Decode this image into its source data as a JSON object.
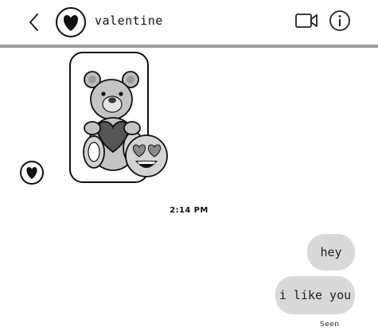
{
  "header": {
    "title": "valentine",
    "back_icon": "chevron-left-icon",
    "avatar_icon": "heart-icon",
    "video_icon": "video-camera-icon",
    "info_icon": "info-icon"
  },
  "messages": {
    "incoming_sticker": "teddy-bear-heart-sticker",
    "reaction": "heart-eyes-emoji-icon",
    "sender_avatar_icon": "heart-icon",
    "timestamp": "2:14 PM",
    "outgoing": [
      {
        "text": "hey"
      },
      {
        "text": "i like you"
      }
    ],
    "status": "Seen"
  },
  "colors": {
    "bubble": "#d9d9d9",
    "divider": "#9a9a9a"
  }
}
